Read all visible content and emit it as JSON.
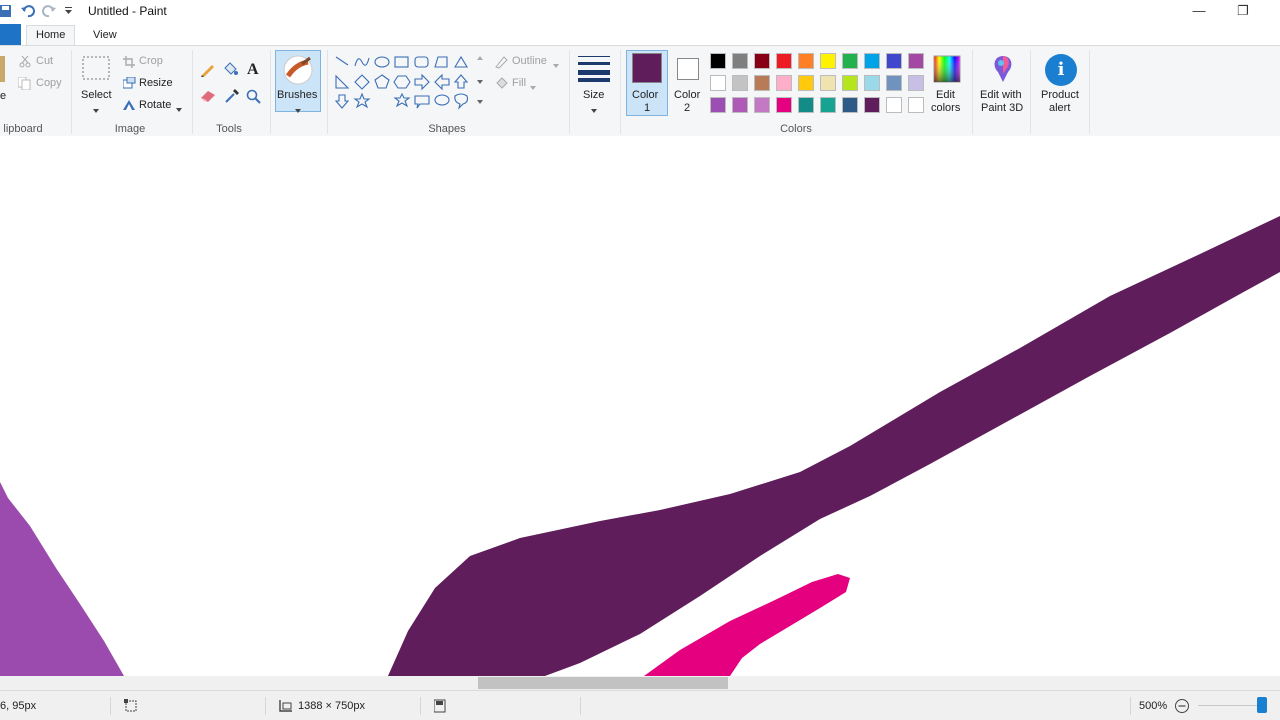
{
  "window": {
    "title": "Untitled - Paint",
    "minimize": "—",
    "restore": "❐"
  },
  "tabs": {
    "file": "",
    "home": "Home",
    "view": "View"
  },
  "clipboard": {
    "label": "lipboard",
    "paste_partial": "e",
    "cut": "Cut",
    "copy": "Copy"
  },
  "image": {
    "label": "Image",
    "select": "Select",
    "crop": "Crop",
    "resize": "Resize",
    "rotate": "Rotate"
  },
  "tools": {
    "label": "Tools"
  },
  "brushes": {
    "label": "Brushes"
  },
  "shapes": {
    "label": "Shapes",
    "outline": "Outline",
    "fill": "Fill"
  },
  "size": {
    "label": "Size"
  },
  "colors": {
    "label": "Colors",
    "color1_line1": "Color",
    "color1_line2": "1",
    "color2_line1": "Color",
    "color2_line2": "2",
    "color1_value": "#5f1e5b",
    "color2_value": "#ffffff",
    "edit_line1": "Edit",
    "edit_line2": "colors",
    "palette": [
      "#000000",
      "#7f7f7f",
      "#880015",
      "#ed1c24",
      "#ff7f27",
      "#fff200",
      "#22b14c",
      "#00a2e8",
      "#3f48cc",
      "#a349a4",
      "#ffffff",
      "#c3c3c3",
      "#b97a57",
      "#ffaec9",
      "#ffc90e",
      "#efe4b0",
      "#b5e61d",
      "#99d9ea",
      "#7092be",
      "#c8bfe7",
      "#9b4fb3",
      "#b05ab8",
      "#c479c5",
      "#e4007f",
      "#138b87",
      "#17a392",
      "#2e5a87",
      "#5f1e5b",
      "#ffffff",
      "#ffffff"
    ]
  },
  "paint3d": {
    "line1": "Edit with",
    "line2": "Paint 3D"
  },
  "product_alert": {
    "line1": "Product",
    "line2": "alert",
    "icon": "i"
  },
  "drawing": {
    "dark_purple": "#5f1e5b",
    "light_purple": "#9b4aad",
    "pink": "#e4007f"
  },
  "status": {
    "position": "6, 95px",
    "canvas_size": "1388 × 750px",
    "zoom": "500%"
  }
}
